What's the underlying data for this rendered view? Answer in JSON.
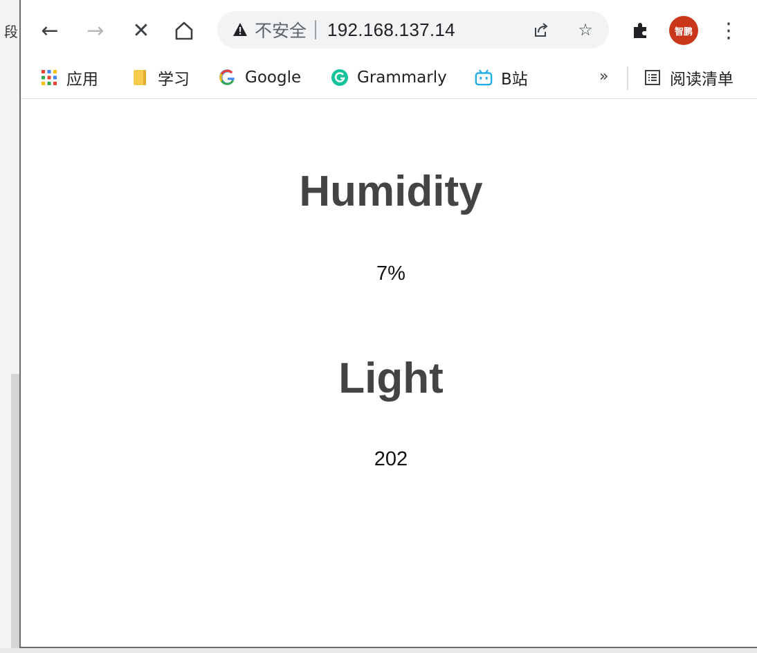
{
  "left_strip": {
    "glyph": "段"
  },
  "toolbar": {
    "back_icon": "←",
    "forward_icon": "→",
    "stop_icon": "✕",
    "home_icon": "⌂",
    "security_label": "不安全",
    "url": "192.168.137.14",
    "share_icon": "share-icon",
    "star_glyph": "☆",
    "extensions_glyph": "✱",
    "avatar_text": "智鹏",
    "menu_glyph": "⋮"
  },
  "bookmarks": {
    "items": [
      {
        "label": "应用",
        "icon": "apps-grid-icon"
      },
      {
        "label": "学习",
        "icon": "folder-icon"
      },
      {
        "label": "Google",
        "icon": "google-icon"
      },
      {
        "label": "Grammarly",
        "icon": "grammarly-icon"
      },
      {
        "label": "B站",
        "icon": "bilibili-icon"
      }
    ],
    "more_glyph": "»",
    "reading_list_label": "阅读清单"
  },
  "main": {
    "humidity_title": "Humidity",
    "humidity_value": "7%",
    "light_title": "Light",
    "light_value": "202"
  },
  "colors": {
    "avatar_bg": "#c9361a",
    "grammarly": "#15c39a",
    "bilibili": "#23ade5",
    "folder": "#f7cb4d"
  }
}
